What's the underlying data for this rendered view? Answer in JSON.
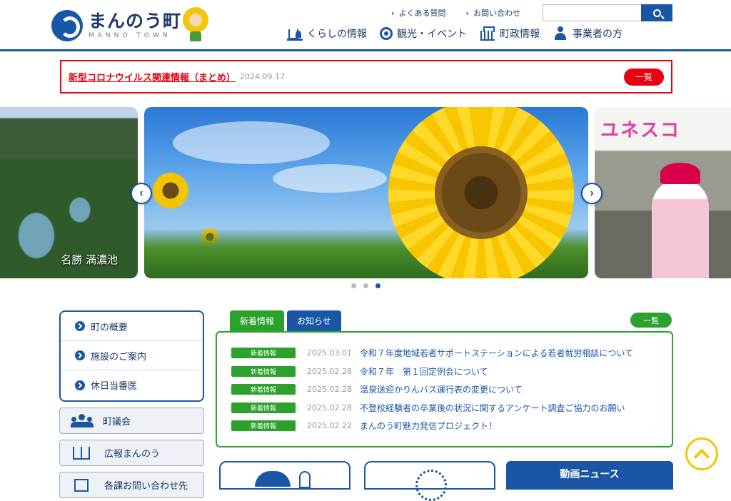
{
  "header": {
    "logo_title": "まんのう町",
    "logo_subtitle": "MANNO TOWN",
    "top_links": [
      "よくある質問",
      "お問い合わせ"
    ],
    "search": {
      "placeholder": "",
      "button_icon": "search-icon"
    },
    "nav": [
      {
        "label": "くらしの情報",
        "icon": "house-icon"
      },
      {
        "label": "観光・イベント",
        "icon": "flower-icon"
      },
      {
        "label": "町政情報",
        "icon": "town-hall-icon"
      },
      {
        "label": "事業者の方",
        "icon": "person-icon"
      }
    ]
  },
  "alert": {
    "title": "新型コロナウイルス関連情報（まとめ）",
    "date": "2024.09.17",
    "button": "一覧"
  },
  "carousel": {
    "left_caption": "名勝 満濃池",
    "right_caption": "ユネスコ",
    "prev_icon": "chevron-left-icon",
    "next_icon": "chevron-right-icon",
    "dots": 3,
    "active_dot": 3
  },
  "left_menu": {
    "items": [
      "町の概要",
      "施設のご案内",
      "休日当番医"
    ],
    "cards": [
      "町議会",
      "広報まんのう",
      "各課お問い合わせ先"
    ]
  },
  "news": {
    "tabs": [
      "新着情報",
      "お知らせ"
    ],
    "more_button": "一覧",
    "items": [
      {
        "badge": "新着情報",
        "date": "2025.03.01",
        "title": "令和７年度地域若者サポートステーションによる若者就労相談について"
      },
      {
        "badge": "新着情報",
        "date": "2025.02.28",
        "title": "令和７年　第１回定例会について"
      },
      {
        "badge": "新着情報",
        "date": "2025.02.28",
        "title": "温泉送迎かりんバス運行表の変更について"
      },
      {
        "badge": "新着情報",
        "date": "2025.02.28",
        "title": "不登校経験者の卒業後の状況に関するアンケート調査ご協力のお願い"
      },
      {
        "badge": "新着情報",
        "date": "2025.02.22",
        "title": "まんのう町魅力発信プロジェクト！"
      }
    ]
  },
  "bottom": {
    "video_news": "動画ニュース"
  },
  "colors": {
    "primary": "#1a56a6",
    "alert": "#e60012",
    "news_green": "#2da12d",
    "totop_yellow": "#f3c60b"
  }
}
